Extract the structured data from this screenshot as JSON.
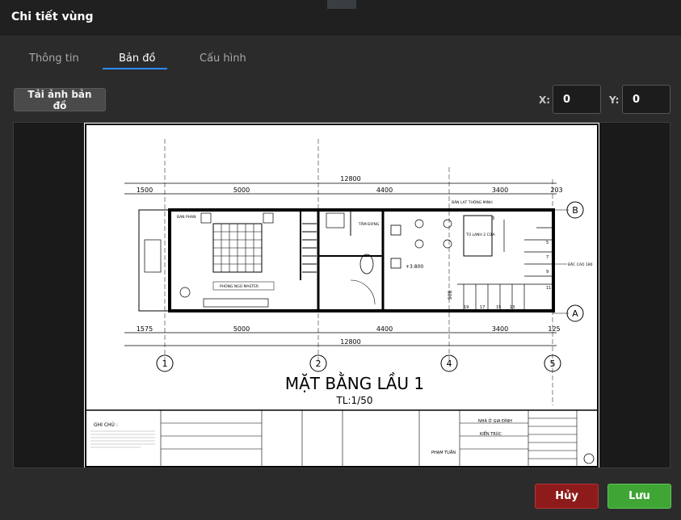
{
  "dialog": {
    "title": "Chi tiết vùng"
  },
  "tabs": [
    {
      "label": "Thông tin",
      "active": false
    },
    {
      "label": "Bản đồ",
      "active": true
    },
    {
      "label": "Cấu hình",
      "active": false
    }
  ],
  "toolbar": {
    "upload_label": "Tải ảnh bản đồ",
    "x_label": "X:",
    "x_value": "0",
    "y_label": "Y:",
    "y_value": "0"
  },
  "drawing": {
    "title": "MẶT BẰNG LẦU 1",
    "scale": "TL:1/50",
    "dim_total_top": "12800",
    "dim_total_bottom": "12800",
    "dims_top": [
      "1500",
      "5000",
      "4400",
      "3400",
      "203"
    ],
    "dims_bottom": [
      "1575",
      "5000",
      "4400",
      "3400",
      "125"
    ],
    "grid_numbers": [
      "1",
      "2",
      "4",
      "5"
    ],
    "grid_letters": [
      "B",
      "A"
    ],
    "room_labels": [
      "BAN PHAN",
      "PHÒNG NGỦ MASTER",
      "TĂM ĐỨNG",
      "TỦ LẠNH 2 CỬA",
      "BÀN LẠT THÔNG MINH",
      "BẬC CAO 180"
    ],
    "level_mark": "+3.800",
    "stair_numbers": [
      "3",
      "5",
      "7",
      "9",
      "11",
      "13",
      "15",
      "17",
      "19"
    ],
    "side_dim": "908",
    "titleblock": {
      "notes_label": "GHI CHÚ :",
      "project": "NHÀ Ở GIA ĐÌNH",
      "discipline": "KIẾN TRÚC",
      "signer": "PHẠM TUẤN"
    }
  },
  "footer": {
    "cancel_label": "Hủy",
    "save_label": "Lưu"
  },
  "colors": {
    "accent": "#2d8cf0",
    "cancel": "#8e1b1b",
    "save": "#3fa535"
  }
}
